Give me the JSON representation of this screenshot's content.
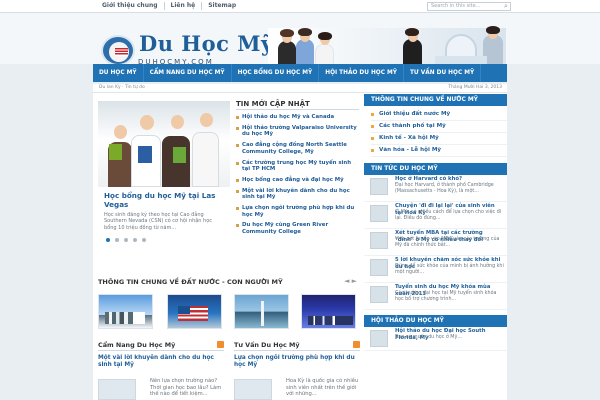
{
  "topnav": {
    "items": [
      "Giới thiệu chung",
      "Liên hệ",
      "Sitemap"
    ],
    "search_placeholder": "Search in this site..."
  },
  "brand": {
    "title": "Du Học Mỹ",
    "subtitle": "DUHOCMY.COM"
  },
  "nav": {
    "items": [
      "DU HỌC MỸ",
      "CẨM NANG DU HỌC MỸ",
      "HỌC BỔNG DU HỌC MỸ",
      "HỘI THẢO DU HỌC MỸ",
      "TƯ VẤN DU HỌC MỸ"
    ]
  },
  "datebar": {
    "left": "Du lan Kỳ · Tin tự do",
    "right": "Tháng Mười Hai 3, 2013"
  },
  "slider": {
    "title": "Học bổng du học Mỹ tại Las Vegas",
    "text": "Học sinh đăng ký theo học tại Cao đẳng Southern Nevada (CSN) có cơ hội nhận học bổng 10 triệu đồng từ năm..."
  },
  "news": {
    "heading": "TIN MỚI CẬP NHẬT",
    "items": [
      "Hội thảo du học Mỹ và Canada",
      "Hội thảo trường Valparaiso University du học Mỹ",
      "Cao đẳng cộng đồng North Seattle Community College, Mỹ",
      "Các trường trung học Mỹ tuyển sinh tại TP HCM",
      "Học bổng cao đẳng và đại học Mỹ",
      "Một vài lời khuyên dành cho du học sinh tại Mỹ",
      "Lựa chọn ngôi trường phù hợp khi du học Mỹ",
      "Du học Mỹ cùng Green River Community College"
    ]
  },
  "country": {
    "heading": "THÔNG TIN CHUNG VỀ ĐẤT NƯỚC - CON NGƯỜI MỸ",
    "prev": "◄",
    "next": "►"
  },
  "lower": {
    "left": {
      "heading": "Cẩm Nang Du Học Mỹ",
      "title": "Một vài lời khuyên dành cho du học sinh tại Mỹ",
      "text": "Nên lựa chọn trường nào? Thời gian học bao lâu? Làm thế nào để tiết kiệm..."
    },
    "right": {
      "heading": "Tư Vấn Du Học Mỹ",
      "title": "Lựa chọn ngôi trường phù hợp khi du học Mỹ",
      "text": "Hoa Kỳ là quốc gia có nhiều sinh viên nhất trên thế giới với những..."
    }
  },
  "side": {
    "section1": {
      "heading": "THÔNG TIN CHUNG VỀ NƯỚC MỸ",
      "items": [
        "Giới thiệu đất nước Mỹ",
        "Các thành phố tại Mỹ",
        "Kinh tế - Xã hội Mỹ",
        "Văn hóa - Lễ hội Mỹ"
      ]
    },
    "section2": {
      "heading": "TIN TỨC DU HỌC MỸ",
      "items": [
        {
          "title": "Học ở Harvard có khó?",
          "text": "Đại học Harvard, ở thành phố Cambridge (Massachusetts - Hoa Kỳ), là một..."
        },
        {
          "title": "Chuyện 'đi đi lại lại' của sinh viên tại Hoa Kỳ",
          "text": "Ở Mỹ, có nhiều cách để lựa chọn cho việc đi lại. Điều đó đúng..."
        },
        {
          "title": "Xét tuyển MBA tại các trường \"đỉnh\" ở Mỹ có nhiều thay đổi",
          "text": "Việc xét tuyển vào MBA vào các trường của Mỹ đã chính thức bắt..."
        },
        {
          "title": "5 lời khuyên chăm sóc sức khỏe khi du học",
          "text": "Đừng để sức khỏe của mình bị ảnh hưởng khi một người..."
        },
        {
          "title": "Tuyển sinh du học Mỹ khóa mùa xuân 2013",
          "text": "Các trường đại học tại Mỹ tuyển sinh khóa học bổ trợ chương trình..."
        }
      ]
    },
    "section3": {
      "heading": "HỘI THẢO DU HỌC MỸ",
      "items": [
        {
          "title": "Hội thảo du học Đại học South Florida, Mỹ",
          "text": "Bạn có muốn du học ở Mỹ..."
        }
      ]
    }
  }
}
